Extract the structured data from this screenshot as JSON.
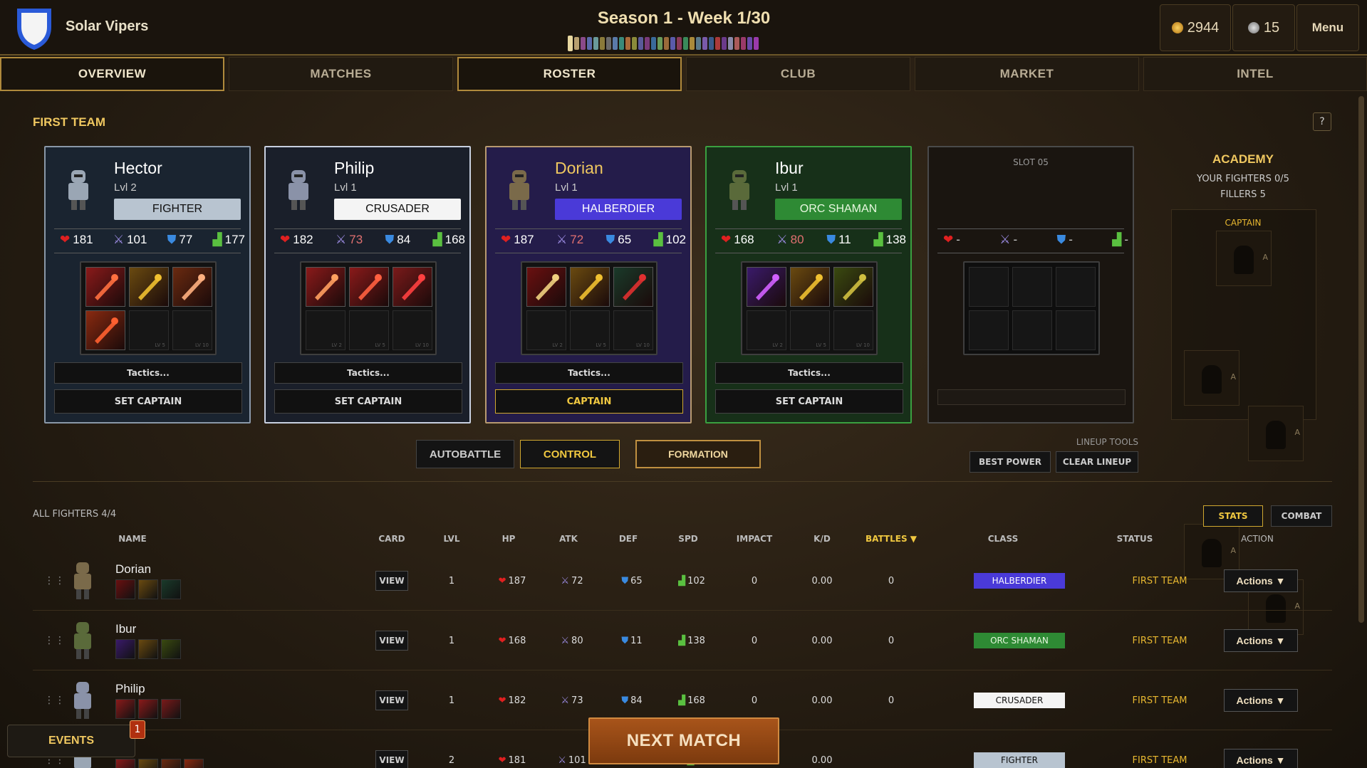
{
  "header": {
    "team_name": "Solar Vipers",
    "season": "Season 1 - Week 1/30",
    "gold": "2944",
    "gems": "15",
    "menu": "Menu"
  },
  "week_bar_colors": [
    "#e8d8a0",
    "#b8a070",
    "#8a4a8a",
    "#5a6aaa",
    "#6a9a9a",
    "#8a7a3a",
    "#6a6a6a",
    "#5a7aaa",
    "#3a8a7a",
    "#aa6a3a",
    "#8a8a3a",
    "#5a5a9a",
    "#7a3a7a",
    "#3a6a9a",
    "#6a9a5a",
    "#9a6a3a",
    "#5a5aaa",
    "#8a3a5a",
    "#3a8a5a",
    "#aa8a3a",
    "#5a7a8a",
    "#7a5aaa",
    "#3a5a8a",
    "#aa3a3a",
    "#6a3a8a",
    "#8a8aaa",
    "#aa5a5a",
    "#9a3a6a",
    "#6a4aaa",
    "#9a3aaa"
  ],
  "tabs": [
    "OVERVIEW",
    "MATCHES",
    "ROSTER",
    "CLUB",
    "MARKET",
    "INTEL"
  ],
  "section_title": "FIRST TEAM",
  "help": "?",
  "cards": [
    {
      "name": "Hector",
      "lvl": "Lvl 2",
      "cls": "FIGHTER",
      "hp": "181",
      "atk": "101",
      "def": "77",
      "spd": "177",
      "tactics": "Tactics...",
      "captain": "SET CAPTAIN"
    },
    {
      "name": "Philip",
      "lvl": "Lvl 1",
      "cls": "CRUSADER",
      "hp": "182",
      "atk": "73",
      "def": "84",
      "spd": "168",
      "tactics": "Tactics...",
      "captain": "SET CAPTAIN"
    },
    {
      "name": "Dorian",
      "lvl": "Lvl 1",
      "cls": "HALBERDIER",
      "hp": "187",
      "atk": "72",
      "def": "65",
      "spd": "102",
      "tactics": "Tactics...",
      "captain": "CAPTAIN"
    },
    {
      "name": "Ibur",
      "lvl": "Lvl 1",
      "cls": "ORC SHAMAN",
      "hp": "168",
      "atk": "80",
      "def": "11",
      "spd": "138",
      "tactics": "Tactics...",
      "captain": "SET CAPTAIN"
    }
  ],
  "slot_lv": {
    "a": "LV 2",
    "b": "LV 5",
    "c": "LV 10"
  },
  "empty_slot": {
    "label": "SLOT 05",
    "dash": "-"
  },
  "academy": {
    "title": "ACADEMY",
    "fighters": "YOUR FIGHTERS 0/5",
    "fillers": "FILLERS 5",
    "captain": "CAPTAIN",
    "a": "A"
  },
  "controls": {
    "autobattle": "AUTOBATTLE",
    "control": "CONTROL",
    "formation": "FORMATION",
    "tools_label": "LINEUP TOOLS",
    "best_power": "BEST POWER",
    "clear_lineup": "CLEAR LINEUP"
  },
  "table": {
    "count_label": "ALL FIGHTERS  4/4",
    "view_stats": "STATS",
    "view_combat": "COMBAT",
    "headers": {
      "name": "NAME",
      "card": "CARD",
      "lvl": "LVL",
      "hp": "HP",
      "atk": "ATK",
      "def": "DEF",
      "spd": "SPD",
      "impact": "IMPACT",
      "kd": "K/D",
      "battles": "BATTLES ▼",
      "class": "CLASS",
      "status": "STATUS",
      "action": "ACTION"
    },
    "rows": [
      {
        "name": "Dorian",
        "view": "VIEW",
        "lvl": "1",
        "hp": "187",
        "atk": "72",
        "def": "65",
        "spd": "102",
        "impact": "0",
        "kd": "0.00",
        "battles": "0",
        "cls": "HALBERDIER",
        "status": "FIRST TEAM",
        "action": "Actions ▼"
      },
      {
        "name": "Ibur",
        "view": "VIEW",
        "lvl": "1",
        "hp": "168",
        "atk": "80",
        "def": "11",
        "spd": "138",
        "impact": "0",
        "kd": "0.00",
        "battles": "0",
        "cls": "ORC SHAMAN",
        "status": "FIRST TEAM",
        "action": "Actions ▼"
      },
      {
        "name": "Philip",
        "view": "VIEW",
        "lvl": "1",
        "hp": "182",
        "atk": "73",
        "def": "84",
        "spd": "168",
        "impact": "0",
        "kd": "0.00",
        "battles": "0",
        "cls": "CRUSADER",
        "status": "FIRST TEAM",
        "action": "Actions ▼"
      },
      {
        "name": "tor",
        "view": "VIEW",
        "lvl": "2",
        "hp": "181",
        "atk": "101",
        "def": "",
        "spd": "",
        "impact": "",
        "kd": "0.00",
        "battles": "",
        "cls": "FIGHTER",
        "status": "FIRST TEAM",
        "action": "Actions ▼"
      }
    ]
  },
  "next_match": "NEXT MATCH",
  "events": "EVENTS",
  "events_count": "1"
}
